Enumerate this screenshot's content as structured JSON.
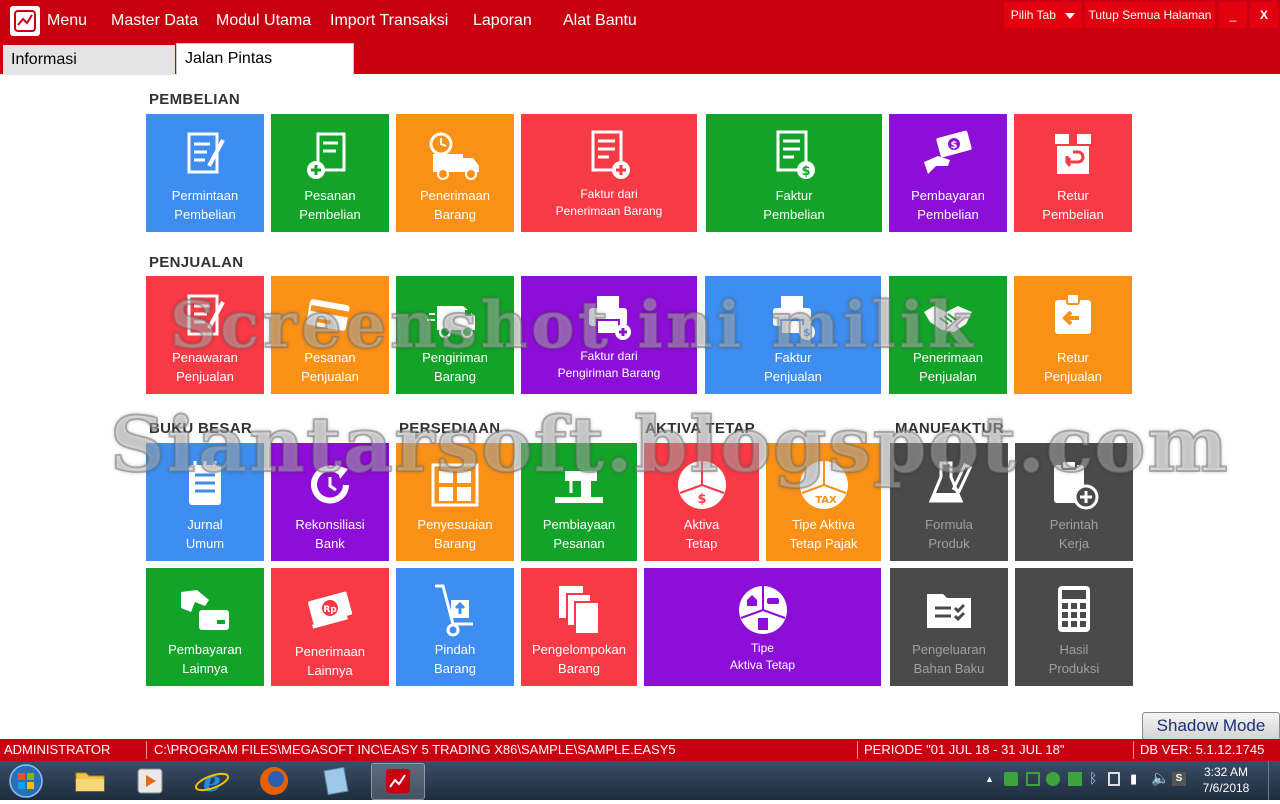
{
  "menubar": {
    "items": [
      "Menu",
      "Master Data",
      "Modul Utama",
      "Import Transaksi",
      "Laporan",
      "Alat Bantu"
    ],
    "pilih_tab": "Pilih Tab",
    "tutup": "Tutup Semua Halaman",
    "minimize": "_",
    "close": "X"
  },
  "tabs": [
    "Informasi",
    "Jalan Pintas"
  ],
  "sections": {
    "pembelian": "PEMBELIAN",
    "penjualan": "PENJUALAN",
    "buku_besar": "BUKU BESAR",
    "persediaan": "PERSEDIAAN",
    "aktiva_tetap": "AKTIVA TETAP",
    "manufaktur": "MANUFAKTUR"
  },
  "tiles": {
    "permintaan_pembelian": [
      "Permintaan",
      "Pembelian"
    ],
    "pesanan_pembelian": [
      "Pesanan",
      "Pembelian"
    ],
    "penerimaan_barang": [
      "Penerimaan",
      "Barang"
    ],
    "faktur_penerimaan": [
      "Faktur dari",
      "Penerimaan Barang"
    ],
    "faktur_pembelian": [
      "Faktur",
      "Pembelian"
    ],
    "pembayaran_pembelian": [
      "Pembayaran",
      "Pembelian"
    ],
    "retur_pembelian": [
      "Retur",
      "Pembelian"
    ],
    "penawaran_penjualan": [
      "Penawaran",
      "Penjualan"
    ],
    "pesanan_penjualan": [
      "Pesanan",
      "Penjualan"
    ],
    "pengiriman_barang": [
      "Pengiriman",
      "Barang"
    ],
    "faktur_pengiriman": [
      "Faktur dari",
      "Pengiriman Barang"
    ],
    "faktur_penjualan": [
      "Faktur",
      "Penjualan"
    ],
    "penerimaan_penjualan": [
      "Penerimaan",
      "Penjualan"
    ],
    "retur_penjualan": [
      "Retur",
      "Penjualan"
    ],
    "jurnal_umum": [
      "Jurnal",
      "Umum"
    ],
    "rekonsiliasi_bank": [
      "Rekonsiliasi",
      "Bank"
    ],
    "penyesuaian_barang": [
      "Penyesuaian",
      "Barang"
    ],
    "pembiayaan_pesanan": [
      "Pembiayaan",
      "Pesanan"
    ],
    "aktiva_tetap": [
      "Aktiva",
      "Tetap"
    ],
    "tipe_aktiva_pajak": [
      "Tipe Aktiva",
      "Tetap Pajak"
    ],
    "formula_produk": [
      "Formula",
      "Produk"
    ],
    "perintah_kerja": [
      "Perintah",
      "Kerja"
    ],
    "pembayaran_lainnya": [
      "Pembayaran",
      "Lainnya"
    ],
    "penerimaan_lainnya": [
      "Penerimaan",
      "Lainnya"
    ],
    "pindah_barang": [
      "Pindah",
      "Barang"
    ],
    "pengelompokan_barang": [
      "Pengelompokan",
      "Barang"
    ],
    "tipe_aktiva_tetap": [
      "Tipe",
      "Aktiva Tetap"
    ],
    "pengeluaran_bahan_baku": [
      "Pengeluaran",
      "Bahan Baku"
    ],
    "hasil_produksi": [
      "Hasil",
      "Produksi"
    ]
  },
  "watermark": {
    "line1": "Screenshot ini milik",
    "line2": "Siantarsoft.blogspot.com"
  },
  "shadow_mode": "Shadow Mode",
  "status": {
    "user": "ADMINISTRATOR",
    "path": "C:\\PROGRAM FILES\\MEGASOFT INC\\EASY 5 TRADING X86\\SAMPLE\\SAMPLE.EASY5",
    "periode": "PERIODE \"01 JUL 18 - 31 JUL 18\"",
    "db_ver": "DB VER: 5.1.12.1745"
  },
  "taskbar": {
    "time": "3:32 AM",
    "date": "7/6/2018"
  },
  "colors": {
    "brand_red": "#c8000f",
    "tile_blue": "#3d8ef0",
    "tile_green": "#14a329",
    "tile_orange": "#fa9117",
    "tile_red": "#f73a45",
    "tile_purple": "#8d0ed6",
    "tile_gray": "#4a4a4a"
  }
}
